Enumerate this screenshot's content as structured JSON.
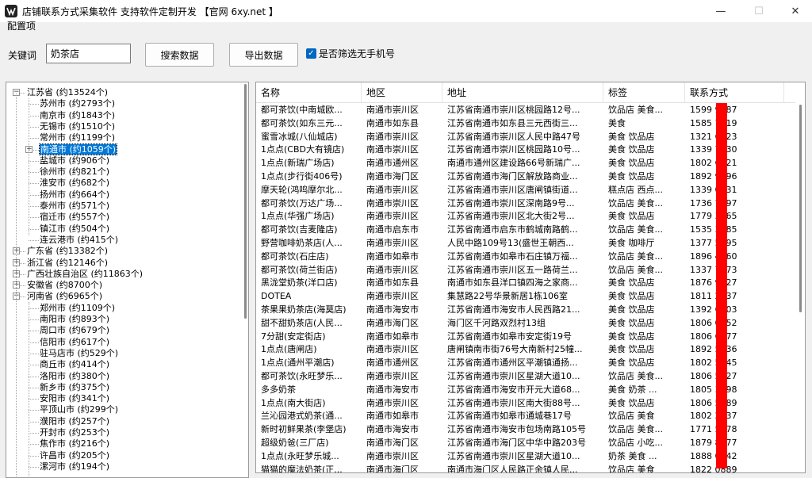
{
  "window": {
    "title": "店铺联系方式采集软件  支持软件定制开发  【官网 6xy.net 】",
    "minimize_glyph": "—",
    "maximize_glyph": "☐",
    "close_glyph": "✕"
  },
  "group_label": "配置项",
  "toolbar": {
    "keyword_label": "关键词",
    "keyword_value": "奶茶店",
    "search_label": "搜索数据",
    "export_label": "导出数据",
    "filter_label": "是否筛选无手机号",
    "filter_checked": true
  },
  "tree": [
    {
      "label": "江苏省 (约13524个)",
      "level": 0,
      "expander": "−"
    },
    {
      "label": "苏州市 (约2793个)",
      "level": 1
    },
    {
      "label": "南京市 (约1843个)",
      "level": 1
    },
    {
      "label": "无锡市 (约1510个)",
      "level": 1
    },
    {
      "label": "常州市 (约1199个)",
      "level": 1
    },
    {
      "label": "南通市 (约1059个)",
      "level": 1,
      "expander": "+",
      "selected": true
    },
    {
      "label": "盐城市 (约906个)",
      "level": 1
    },
    {
      "label": "徐州市 (约821个)",
      "level": 1
    },
    {
      "label": "淮安市 (约682个)",
      "level": 1
    },
    {
      "label": "扬州市 (约664个)",
      "level": 1
    },
    {
      "label": "泰州市 (约571个)",
      "level": 1
    },
    {
      "label": "宿迁市 (约557个)",
      "level": 1
    },
    {
      "label": "镇江市 (约504个)",
      "level": 1
    },
    {
      "label": "连云港市 (约415个)",
      "level": 1
    },
    {
      "label": "广东省 (约13382个)",
      "level": 0,
      "expander": "+"
    },
    {
      "label": "浙江省 (约12146个)",
      "level": 0,
      "expander": "+"
    },
    {
      "label": "广西壮族自治区 (约11863个)",
      "level": 0,
      "expander": "+"
    },
    {
      "label": "安徽省 (约8700个)",
      "level": 0,
      "expander": "+"
    },
    {
      "label": "河南省 (约6965个)",
      "level": 0,
      "expander": "−"
    },
    {
      "label": "郑州市 (约1109个)",
      "level": 1
    },
    {
      "label": "南阳市 (约893个)",
      "level": 1
    },
    {
      "label": "周口市 (约679个)",
      "level": 1
    },
    {
      "label": "信阳市 (约617个)",
      "level": 1
    },
    {
      "label": "驻马店市 (约529个)",
      "level": 1
    },
    {
      "label": "商丘市 (约414个)",
      "level": 1
    },
    {
      "label": "洛阳市 (约380个)",
      "level": 1
    },
    {
      "label": "新乡市 (约375个)",
      "level": 1
    },
    {
      "label": "安阳市 (约341个)",
      "level": 1
    },
    {
      "label": "平顶山市 (约299个)",
      "level": 1
    },
    {
      "label": "濮阳市 (约257个)",
      "level": 1
    },
    {
      "label": "开封市 (约253个)",
      "level": 1
    },
    {
      "label": "焦作市 (约216个)",
      "level": 1
    },
    {
      "label": "许昌市 (约205个)",
      "level": 1
    },
    {
      "label": "漯河市 (约194个)",
      "level": 1
    }
  ],
  "grid": {
    "columns": [
      "名称",
      "地区",
      "地址",
      "标签",
      "联系方式"
    ],
    "rows": [
      [
        "都可茶饮(中南城欧...",
        "南通市崇川区",
        "江苏省南通市崇川区桃园路12号...",
        "饮品店 美食...",
        "1599    9987"
      ],
      [
        "都可茶饮(如东三元...",
        "南通市如东县",
        "江苏省南通市如东县三元西街三...",
        "美食",
        "1585    7719"
      ],
      [
        "蜜雪冰城(八仙城店)",
        "南通市崇川区",
        "江苏省南通市崇川区人民中路47号",
        "美食 饮品店",
        "1321    6623"
      ],
      [
        "1点点(CBD大有镜店)",
        "南通市崇川区",
        "江苏省南通市崇川区桃园路10号...",
        "美食 饮品店",
        "1339    7030"
      ],
      [
        "1点点(新瑞广场店)",
        "南通市通州区",
        "南通市通州区建设路66号新瑞广...",
        "美食 饮品店",
        "1802    6321"
      ],
      [
        "1点点(步行街406号)",
        "南通市海门区",
        "江苏省南通市海门区解放路商业...",
        "美食 饮品店",
        "1892    9996"
      ],
      [
        "摩天轮(鸿鸣摩尔北...",
        "南通市崇川区",
        "江苏省南通市崇川区唐闸镇街道...",
        "糕点店 西点...",
        "1339    0331"
      ],
      [
        "都可茶饮(万达广场...",
        "南通市崇川区",
        "江苏省南通市崇川区深南路9号...",
        "饮品店 美食...",
        "1736    7097"
      ],
      [
        "1点点(华强广场店)",
        "南通市崇川区",
        "江苏省南通市崇川区北大街2号...",
        "美食 饮品店",
        "1779    3865"
      ],
      [
        "都可茶饮(吉麦隆店)",
        "南通市启东市",
        "江苏省南通市启东市鹤城南路鹤...",
        "饮品店 美食...",
        "1535    3685"
      ],
      [
        "野营咖啡奶茶店(人...",
        "南通市崇川区",
        "人民中路109号13(盛世王朝西...",
        "美食 咖啡厅",
        "1377    5695"
      ],
      [
        "都可茶饮(石庄店)",
        "南通市如皋市",
        "江苏省南通市如皋市石庄镇万福...",
        "饮品店 美食...",
        "1896    4160"
      ],
      [
        "都可茶饮(荷兰街店)",
        "南通市崇川区",
        "江苏省南通市崇川区五一路荷兰...",
        "饮品店 美食...",
        "1337    7673"
      ],
      [
        "黑泷堂奶茶(洋口店)",
        "南通市如东县",
        "南通市如东县洋口镇四海之家商...",
        "美食 饮品店",
        "1876    9827"
      ],
      [
        "DOTEA",
        "南通市崇川区",
        "集慧路22号华景新居1栋106室",
        "美食 饮品店",
        "1811    2737"
      ],
      [
        "茶果果奶茶店(海莫店)",
        "南通市海安市",
        "江苏省南通市海安市人民西路21...",
        "美食 饮品店",
        "1392    6003"
      ],
      [
        "甜不甜奶茶店(人民...",
        "南通市海门区",
        "海门区千河路双烈村13组",
        "美食 饮品店",
        "1806    0852"
      ],
      [
        "7分甜(安定街店)",
        "南通市如皋市",
        "江苏省南通市如皋市安定街19号",
        "美食 饮品店",
        "1806    6277"
      ],
      [
        "1点点(唐闸店)",
        "南通市崇川区",
        "唐闸镇南市街76号大南新村25幢...",
        "美食 饮品店",
        "1892    5336"
      ],
      [
        "1点点(通州平潮店)",
        "南通市通州区",
        "江苏省南通市通州区平潮镇通扬...",
        "美食 饮品店",
        "1802    5345"
      ],
      [
        "都可茶饮(永旺梦乐...",
        "南通市崇川区",
        "江苏省南通市崇川区星湖大道10...",
        "饮品店 美食...",
        "1806    5527"
      ],
      [
        "多多奶茶",
        "南通市海安市",
        "江苏省南通市海安市开元大道68...",
        "美食 奶茶 ...",
        "1805    3898"
      ],
      [
        "1点点(南大街店)",
        "南通市崇川区",
        "江苏省南通市崇川区南大街88号...",
        "美食 饮品店",
        "1806    5289"
      ],
      [
        "兰沁园港式奶茶(通...",
        "南通市如皋市",
        "江苏省南通市如皋市通城巷17号",
        "饮品店 美食",
        "1802    2937"
      ],
      [
        "新时初鲜果茶(李堡店)",
        "南通市海安市",
        "江苏省南通市海安市包场南路105号",
        "饮品店 美食...",
        "1771    5278"
      ],
      [
        "超级奶爸(三厂店)",
        "南通市海门区",
        "江苏省南通市海门区中华中路203号",
        "饮品店 小吃...",
        "1879    8077"
      ],
      [
        "1点点(永旺梦乐城...",
        "南通市崇川区",
        "江苏省南通市崇川区星湖大道10...",
        "奶茶 美食 ...",
        "1888    0242"
      ],
      [
        "猫猫的魔法奶茶(正...",
        "南通市海门区",
        "南通市海门区人民路正余镇人民...",
        "饮品店 美食",
        "1822    0889"
      ]
    ]
  },
  "accent_color": "#0078d7",
  "redaction_color": "#ff0000"
}
